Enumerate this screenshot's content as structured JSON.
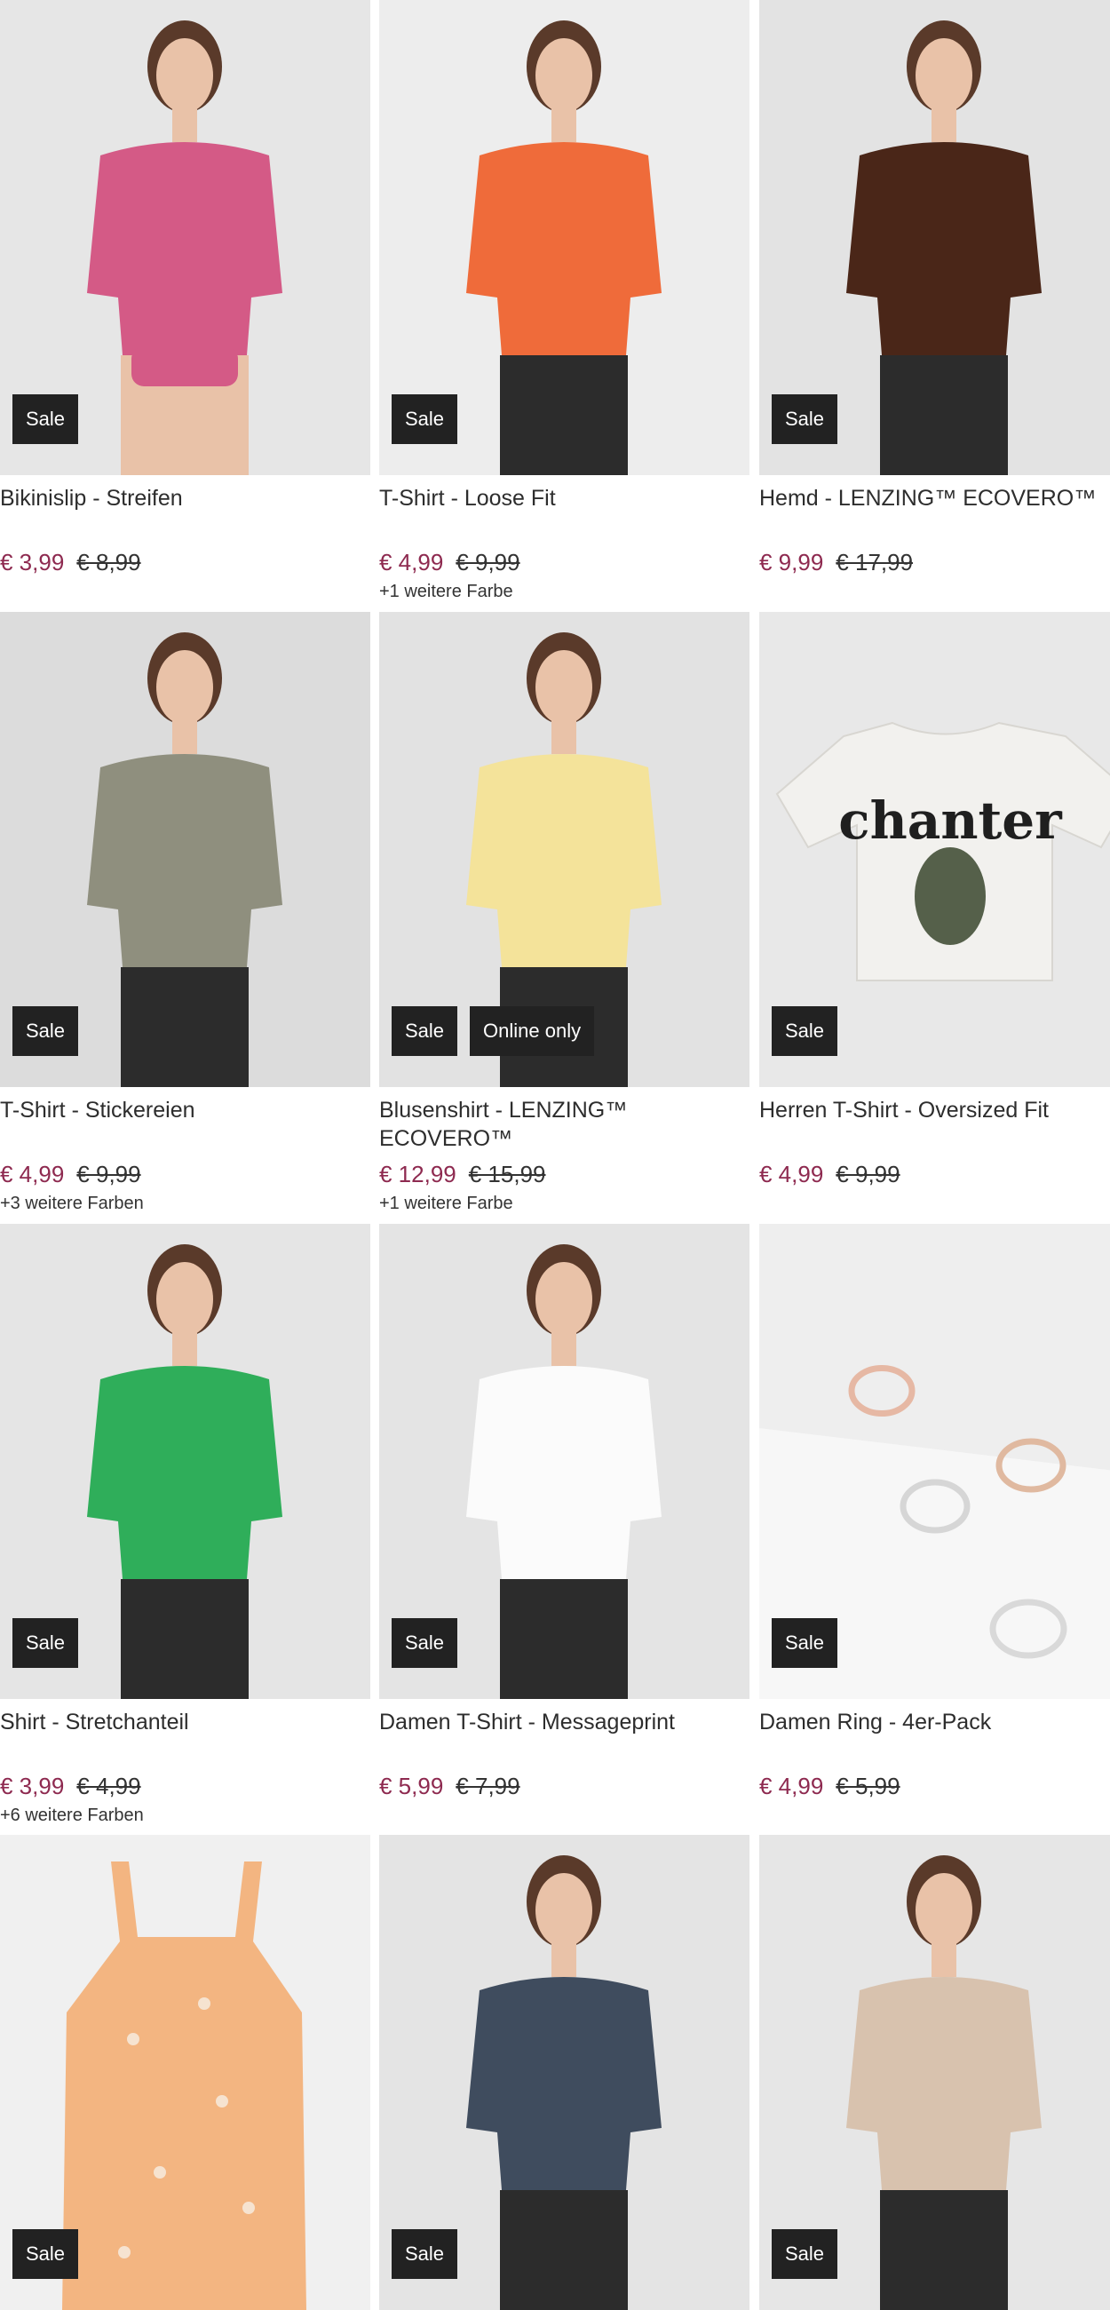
{
  "products": [
    {
      "title": "Bikinislip - Streifen",
      "price": "€ 3,99",
      "old_price": "€ 8,99",
      "badges": [
        "Sale"
      ],
      "colors": "",
      "image": "woman-bikini-photo",
      "bg": "#e6e6e6",
      "garment": "#d45a86"
    },
    {
      "title": "T-Shirt - Loose Fit",
      "price": "€ 4,99",
      "old_price": "€ 9,99",
      "badges": [
        "Sale"
      ],
      "colors": "+1 weitere Farbe",
      "image": "paisley-shirt-back-photo",
      "bg": "#ededed",
      "garment": "#ef6b3a"
    },
    {
      "title": "Hemd - LENZING™ ECOVERO™",
      "price": "€ 9,99",
      "old_price": "€ 17,99",
      "badges": [
        "Sale"
      ],
      "colors": "",
      "image": "man-floral-shirt-photo",
      "bg": "#e3e3e3",
      "garment": "#4a2618"
    },
    {
      "title": "T-Shirt - Stickereien",
      "price": "€ 4,99",
      "old_price": "€ 9,99",
      "badges": [
        "Sale"
      ],
      "colors": "+3 weitere Farben",
      "image": "woman-khaki-tshirt-photo",
      "bg": "#dcdcdc",
      "garment": "#8f8f7e"
    },
    {
      "title": "Blusenshirt - LENZING™ ECOVERO™",
      "price": "€ 12,99",
      "old_price": "€ 15,99",
      "badges": [
        "Sale",
        "Online only"
      ],
      "colors": "+1 weitere Farbe",
      "image": "woman-yellow-blouse-photo",
      "bg": "#e2e2e2",
      "garment": "#f4e39a"
    },
    {
      "title": "Herren T-Shirt - Oversized Fit",
      "price": "€ 4,99",
      "old_price": "€ 9,99",
      "badges": [
        "Sale"
      ],
      "colors": "",
      "image": "chanter-tshirt-flatlay-photo",
      "bg": "#e8e8e8",
      "garment": "#f2f1ee",
      "print_text": "chanter"
    },
    {
      "title": "Shirt - Stretchanteil",
      "price": "€ 3,99",
      "old_price": "€ 4,99",
      "badges": [
        "Sale"
      ],
      "colors": "+6 weitere Farben",
      "image": "woman-green-shirt-photo",
      "bg": "#e5e5e5",
      "garment": "#2fae5a"
    },
    {
      "title": "Damen T-Shirt - Messageprint",
      "price": "€ 5,99",
      "old_price": "€ 7,99",
      "badges": [
        "Sale"
      ],
      "colors": "",
      "image": "woman-white-tshirt-photo",
      "bg": "#e4e4e4",
      "garment": "#fbfbfb"
    },
    {
      "title": "Damen Ring - 4er-Pack",
      "price": "€ 4,99",
      "old_price": "€ 5,99",
      "badges": [
        "Sale"
      ],
      "colors": "",
      "image": "rings-photo",
      "bg": "#eeeeee",
      "garment": "#cfcfcf"
    },
    {
      "title": "",
      "price": "",
      "old_price": "",
      "badges": [
        "Sale"
      ],
      "colors": "",
      "image": "peach-dress-photo",
      "bg": "#f0f0f0",
      "garment": "#f3b581"
    },
    {
      "title": "",
      "price": "",
      "old_price": "",
      "badges": [
        "Sale"
      ],
      "colors": "",
      "image": "man-patterned-shirt-photo",
      "bg": "#e4e4e4",
      "garment": "#3f4c5e"
    },
    {
      "title": "",
      "price": "",
      "old_price": "",
      "badges": [
        "Sale"
      ],
      "colors": "",
      "image": "woman-leaf-print-top-photo",
      "bg": "#e6e6e6",
      "garment": "#d8c2ae"
    }
  ]
}
